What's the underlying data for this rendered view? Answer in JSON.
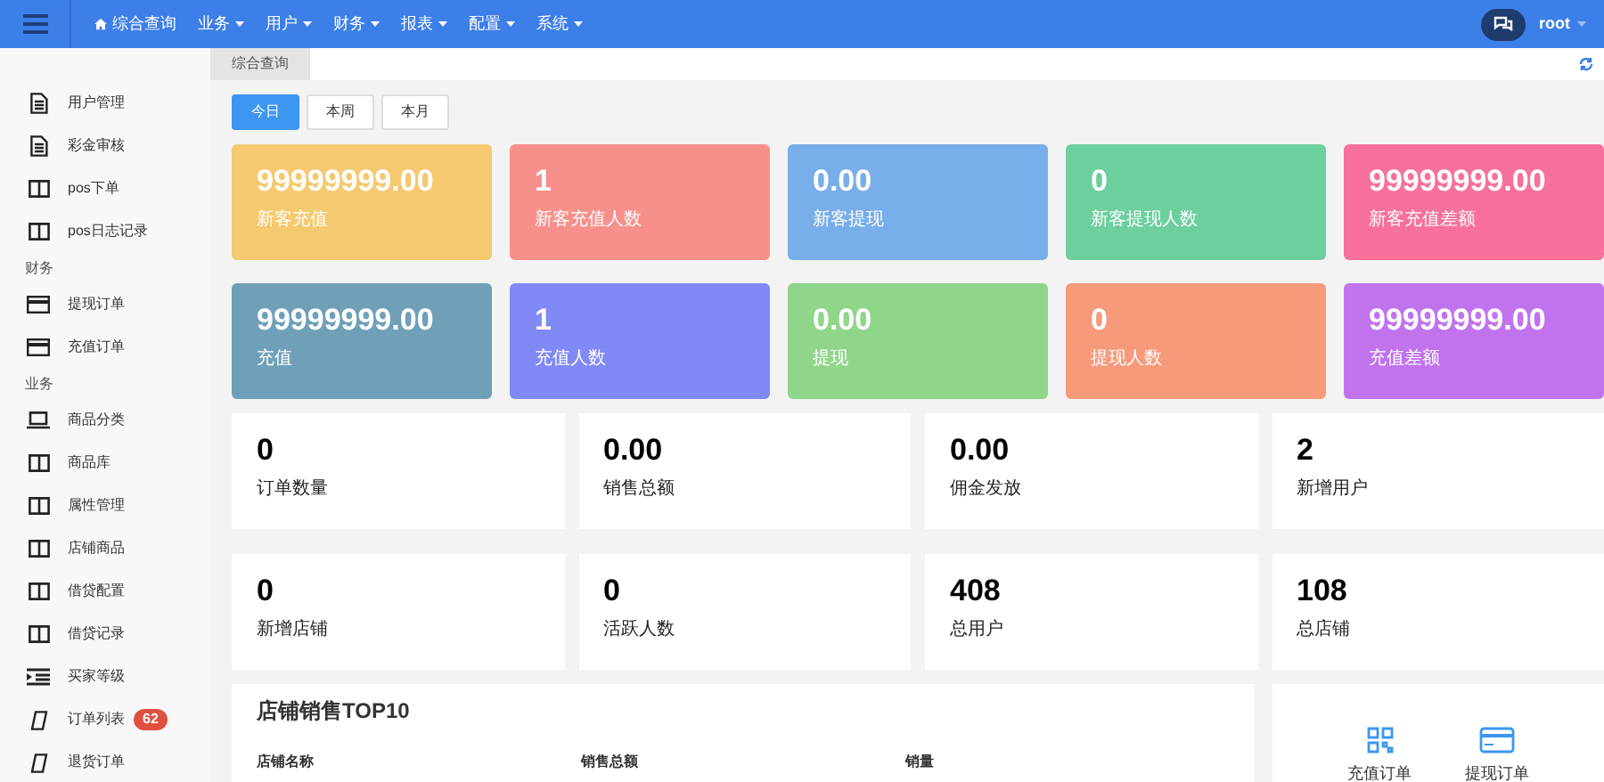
{
  "top_nav": {
    "items": [
      {
        "label": "综合查询",
        "kind": "home"
      },
      {
        "label": "业务",
        "kind": "dropdown"
      },
      {
        "label": "用户",
        "kind": "dropdown"
      },
      {
        "label": "财务",
        "kind": "dropdown"
      },
      {
        "label": "报表",
        "kind": "dropdown"
      },
      {
        "label": "配置",
        "kind": "dropdown"
      },
      {
        "label": "系统",
        "kind": "dropdown"
      }
    ],
    "user": "root"
  },
  "sidebar": {
    "sections": [
      {
        "items": [
          {
            "label": "用户管理",
            "kind": "file"
          },
          {
            "label": "彩金审核",
            "kind": "file"
          },
          {
            "label": "pos下单",
            "kind": "columns"
          },
          {
            "label": "pos日志记录",
            "kind": "columns"
          }
        ]
      },
      {
        "title": "财务",
        "items": [
          {
            "label": "提现订单",
            "kind": "card"
          },
          {
            "label": "充值订单",
            "kind": "card"
          }
        ]
      },
      {
        "title": "业务",
        "items": [
          {
            "label": "商品分类",
            "kind": "laptop"
          },
          {
            "label": "商品库",
            "kind": "columns"
          },
          {
            "label": "属性管理",
            "kind": "columns"
          },
          {
            "label": "店铺商品",
            "kind": "columns"
          },
          {
            "label": "借贷配置",
            "kind": "columns"
          },
          {
            "label": "借贷记录",
            "kind": "columns"
          },
          {
            "label": "买家等级",
            "kind": "indent"
          },
          {
            "label": "订单列表",
            "kind": "tag",
            "badge": "62"
          },
          {
            "label": "退货订单",
            "kind": "tag"
          }
        ]
      }
    ]
  },
  "page_tabs": [
    {
      "label": "综合查询",
      "selected": true
    }
  ],
  "period_buttons": [
    {
      "label": "今日",
      "selected": true
    },
    {
      "label": "本周",
      "selected": false
    },
    {
      "label": "本月",
      "selected": false
    }
  ],
  "color_stats": [
    {
      "value": "99999999.00",
      "label": "新客充值",
      "color": "#f5c96f"
    },
    {
      "value": "1",
      "label": "新客充值人数",
      "color": "#f7908b"
    },
    {
      "value": "0.00",
      "label": "新客提现",
      "color": "#78aeea"
    },
    {
      "value": "0",
      "label": "新客提现人数",
      "color": "#6dcf9e"
    },
    {
      "value": "99999999.00",
      "label": "新客充值差额",
      "color": "#f7719a"
    },
    {
      "value": "99999999.00",
      "label": "充值",
      "color": "#6fa0b8"
    },
    {
      "value": "1",
      "label": "充值人数",
      "color": "#8189f7"
    },
    {
      "value": "0.00",
      "label": "提现",
      "color": "#8fd68a"
    },
    {
      "value": "0",
      "label": "提现人数",
      "color": "#f79a7b"
    },
    {
      "value": "99999999.00",
      "label": "充值差额",
      "color": "#c173ee"
    }
  ],
  "white_stats": [
    {
      "value": "0",
      "label": "订单数量"
    },
    {
      "value": "0.00",
      "label": "销售总额"
    },
    {
      "value": "0.00",
      "label": "佣金发放"
    },
    {
      "value": "2",
      "label": "新增用户"
    },
    {
      "value": "0",
      "label": "新增店铺"
    },
    {
      "value": "0",
      "label": "活跃人数"
    },
    {
      "value": "408",
      "label": "总用户"
    },
    {
      "value": "108",
      "label": "总店铺"
    }
  ],
  "sales_table": {
    "title": "店铺销售TOP10",
    "columns": [
      "店铺名称",
      "销售总额",
      "销量"
    ]
  },
  "shortcuts": [
    {
      "label": "充值订单",
      "kind": "qr"
    },
    {
      "label": "提现订单",
      "kind": "card"
    }
  ]
}
